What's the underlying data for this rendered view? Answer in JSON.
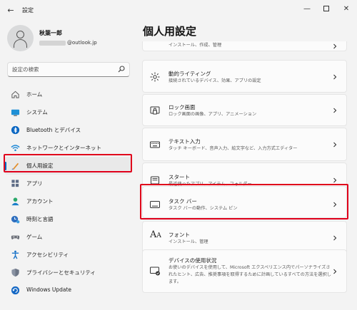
{
  "window": {
    "title": "設定",
    "back_icon": "back-arrow-icon",
    "minimize_icon": "minimize-icon",
    "maximize_icon": "maximize-icon",
    "close_icon": "close-icon"
  },
  "user": {
    "name": "秋葉一郎",
    "email_suffix": "@outlook.jp",
    "avatar_icon": "person-icon"
  },
  "search": {
    "placeholder": "設定の検索",
    "icon": "search-icon"
  },
  "sidebar": {
    "items": [
      {
        "label": "ホーム",
        "icon": "home-icon"
      },
      {
        "label": "システム",
        "icon": "system-display-icon"
      },
      {
        "label": "Bluetooth とデバイス",
        "icon": "bluetooth-icon"
      },
      {
        "label": "ネットワークとインターネット",
        "icon": "wifi-icon"
      },
      {
        "label": "個人用設定",
        "icon": "paintbrush-icon",
        "selected": true
      },
      {
        "label": "アプリ",
        "icon": "apps-icon"
      },
      {
        "label": "アカウント",
        "icon": "account-icon"
      },
      {
        "label": "時刻と言語",
        "icon": "time-language-icon"
      },
      {
        "label": "ゲーム",
        "icon": "gamepad-icon"
      },
      {
        "label": "アクセシビリティ",
        "icon": "accessibility-icon"
      },
      {
        "label": "プライバシーとセキュリティ",
        "icon": "shield-icon"
      },
      {
        "label": "Windows Update",
        "icon": "windows-update-icon"
      }
    ]
  },
  "main": {
    "title": "個人用設定",
    "cards": [
      {
        "title": "",
        "desc": "インストール、作成、管理",
        "icon": "",
        "partial": true
      },
      {
        "title": "動的ライティング",
        "desc": "接続されているデバイス、効果、アプリの設定",
        "icon": "dynamic-lighting-icon"
      },
      {
        "title": "ロック画面",
        "desc": "ロック画面の画像、アプリ、アニメーション",
        "icon": "lock-screen-icon"
      },
      {
        "title": "テキスト入力",
        "desc": "タッチ キーボード、音声入力、絵文字など、入力方式エディター",
        "icon": "keyboard-icon"
      },
      {
        "title": "スタート",
        "desc": "最近使ったアプリ、アイテム、フォルダー",
        "icon": "start-menu-icon"
      },
      {
        "title": "タスク バー",
        "desc": "タスク バーの動作、システム ピン",
        "icon": "taskbar-icon",
        "highlighted": true
      },
      {
        "title": "フォント",
        "desc": "インストール、管理",
        "icon": "fonts-icon"
      },
      {
        "title": "デバイスの使用状況",
        "desc_lines": [
          "お使いのデバイスを使用して、Microsoft エクスペリエンス内でパーソナライズさ",
          "れたヒント、広告、推奨事項を取得するために計画しているすべての方法を選択し",
          "ます。"
        ],
        "icon": "device-usage-icon"
      }
    ],
    "chevron_icon": "chevron-right-icon"
  },
  "colors": {
    "accent": "#0067c0",
    "highlight_red": "#e0001b",
    "background": "#f3f3f3",
    "card": "#fbfbfb"
  }
}
